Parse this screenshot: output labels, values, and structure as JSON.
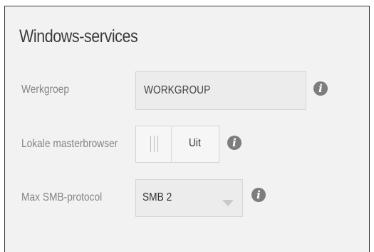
{
  "section": {
    "title": "Windows-services"
  },
  "workgroup": {
    "label": "Werkgroep",
    "value": "WORKGROUP",
    "info_icon": "info-icon"
  },
  "master_browser": {
    "label": "Lokale masterbrowser",
    "state": "Uit",
    "enabled": false,
    "info_icon": "info-icon"
  },
  "smb_protocol": {
    "label": "Max SMB-protocol",
    "selected": "SMB 2",
    "dropdown_icon": "chevron-down-icon",
    "info_icon": "info-icon"
  },
  "info_glyph": "i",
  "colors": {
    "background": "#f2f2f2",
    "field": "#ececec",
    "label": "#858585",
    "icon": "#7d7d7d"
  }
}
